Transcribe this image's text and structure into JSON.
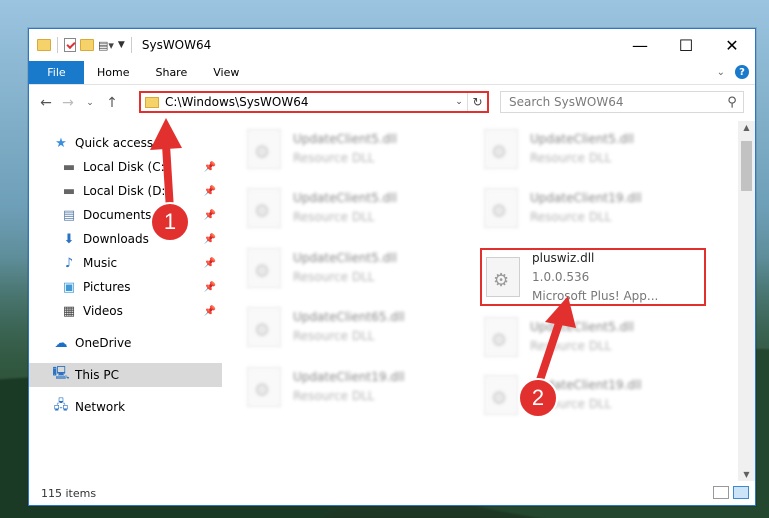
{
  "window": {
    "title": "SysWOW64",
    "controls": {
      "minimize": "—",
      "maximize": "☐",
      "close": "✕"
    }
  },
  "ribbon": {
    "tabs": [
      "File",
      "Home",
      "Share",
      "View"
    ],
    "help": "?"
  },
  "address": {
    "path": "C:\\Windows\\SysWOW64",
    "search_placeholder": "Search SysWOW64"
  },
  "sidebar": {
    "quick_access": "Quick access",
    "items": [
      {
        "label": "Local Disk (C:)",
        "icon": "drive-icon"
      },
      {
        "label": "Local Disk (D:)",
        "icon": "drive-icon"
      },
      {
        "label": "Documents",
        "icon": "documents-icon"
      },
      {
        "label": "Downloads",
        "icon": "download-icon"
      },
      {
        "label": "Music",
        "icon": "music-icon"
      },
      {
        "label": "Pictures",
        "icon": "pictures-icon"
      },
      {
        "label": "Videos",
        "icon": "videos-icon"
      }
    ],
    "onedrive": "OneDrive",
    "this_pc": "This PC",
    "network": "Network"
  },
  "files": [
    {
      "name": "UpdateClient5.dll",
      "type": "Resource DLL"
    },
    {
      "name": "UpdateClient5.dll",
      "type": "Resource DLL"
    },
    {
      "name": "UpdateClient5.dll",
      "type": "Resource DLL"
    },
    {
      "name": "UpdateClient19.dll",
      "type": "Resource DLL"
    },
    {
      "name": "UpdateClient5.dll",
      "type": "Resource DLL"
    },
    {
      "name": "pluswiz.dll",
      "version": "1.0.0.536",
      "description": "Microsoft Plus! App..."
    },
    {
      "name": "UpdateClient65.dll",
      "type": "Resource DLL"
    },
    {
      "name": "UpdateClient5.dll",
      "type": "Resource DLL"
    },
    {
      "name": "UpdateClient19.dll",
      "type": "Resource DLL"
    },
    {
      "name": "UpdateClient19.dll",
      "type": "Resource DLL"
    }
  ],
  "status": {
    "item_count": "115 items"
  },
  "annotations": {
    "step1": "1",
    "step2": "2"
  },
  "colors": {
    "accent": "#1979ca",
    "highlight": "#e2302e"
  }
}
